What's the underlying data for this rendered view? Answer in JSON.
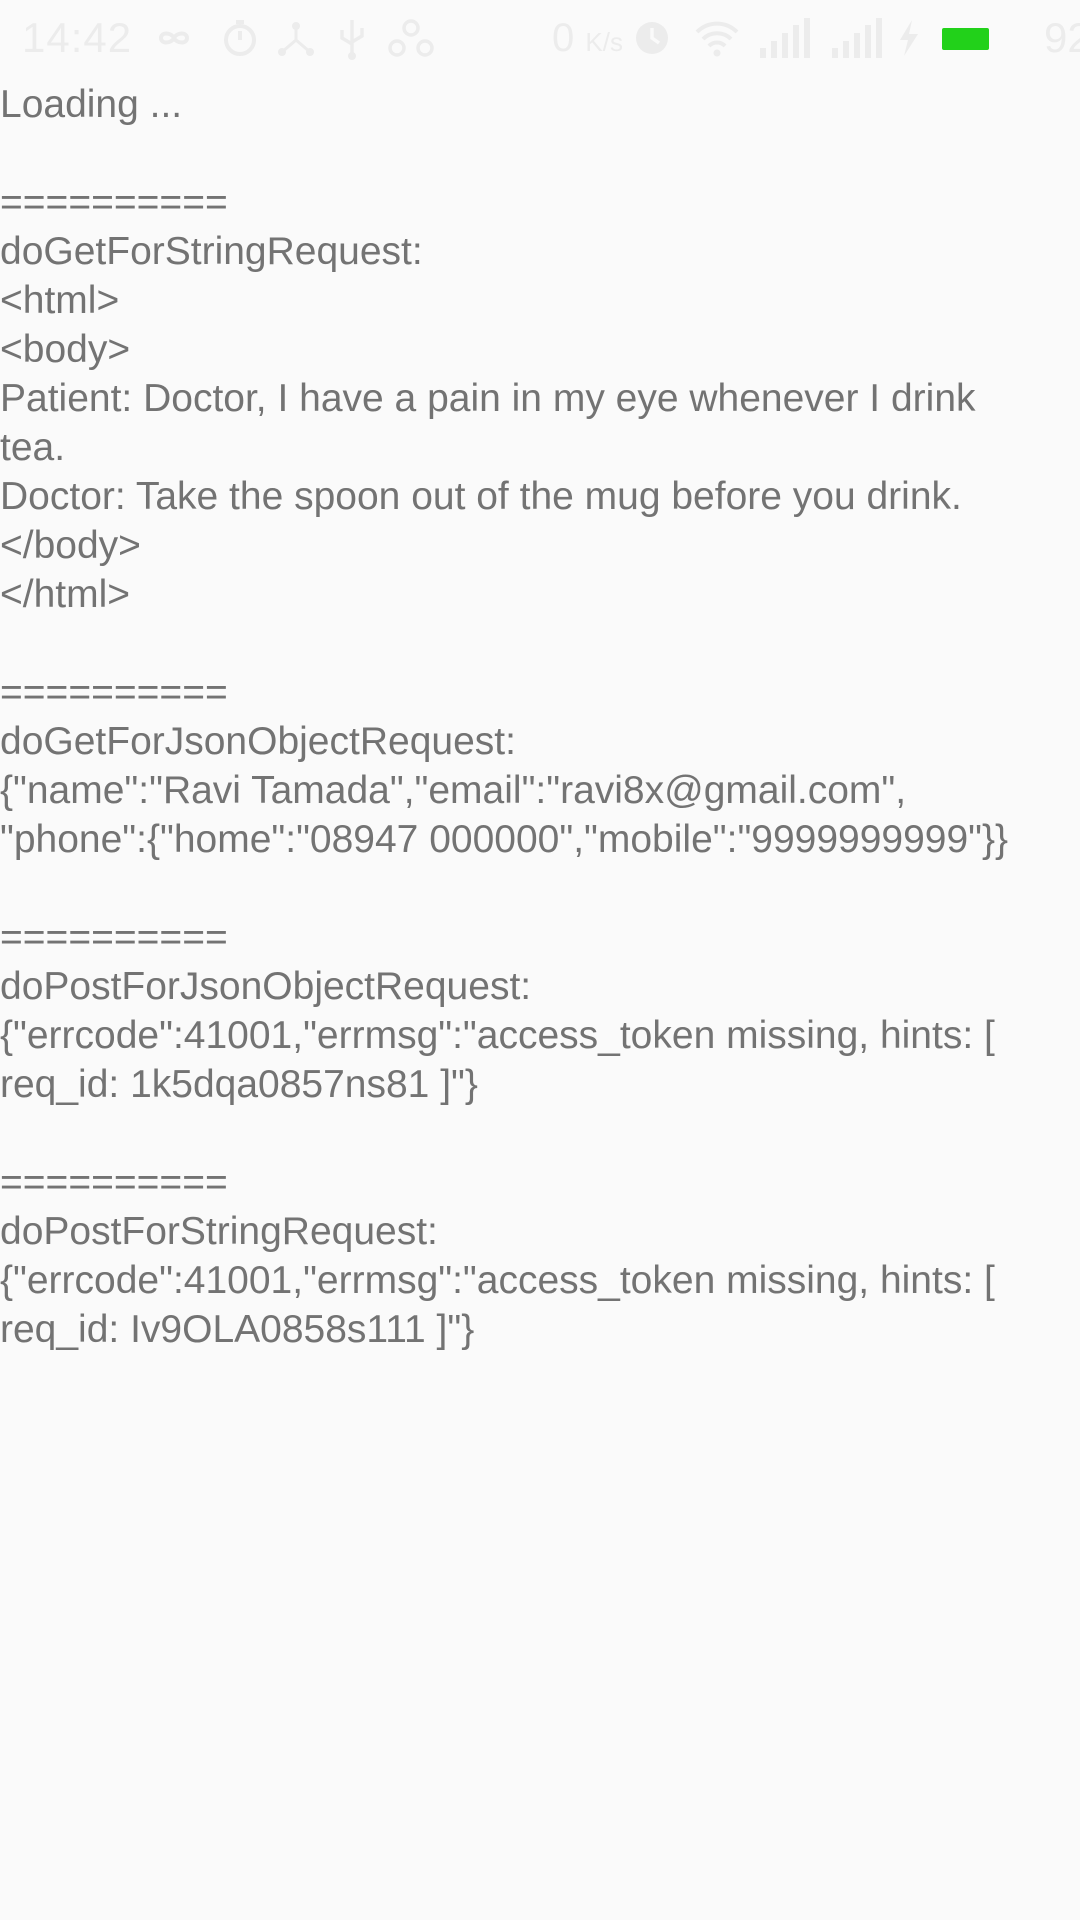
{
  "status_bar": {
    "time": "14:42",
    "speed": "0",
    "speed_unit": "K/s",
    "battery_level": "92",
    "battery_fill_fraction": 0.9,
    "battery_color": "#22d11a",
    "icons": [
      "infinity-icon",
      "timer-icon",
      "share-icon",
      "usb-icon",
      "link-icon",
      "alarm-icon",
      "wifi-icon",
      "signal-4g-icon",
      "signal-icon",
      "charging-icon",
      "battery-icon"
    ]
  },
  "log": {
    "lines": [
      "Loading ...",
      "",
      "==========",
      "doGetForStringRequest:",
      "<html>",
      "<body>",
      "Patient: Doctor, I have a pain in my eye whenever I drink",
      "tea.",
      "Doctor: Take the spoon out of the mug before you drink.",
      "</body>",
      "</html>",
      "",
      "==========",
      "doGetForJsonObjectRequest:",
      "{\"name\":\"Ravi Tamada\",\"email\":\"ravi8x@gmail.com\",",
      "\"phone\":{\"home\":\"08947 000000\",\"mobile\":\"9999999999\"}}",
      "",
      "==========",
      "doPostForJsonObjectRequest:",
      "{\"errcode\":41001,\"errmsg\":\"access_token missing, hints: [",
      "req_id: 1k5dqa0857ns81 ]\"}",
      "",
      "==========",
      "doPostForStringRequest:",
      "{\"errcode\":41001,\"errmsg\":\"access_token missing, hints: [",
      "req_id: Iv9OLA0858s111 ]\"}"
    ]
  }
}
